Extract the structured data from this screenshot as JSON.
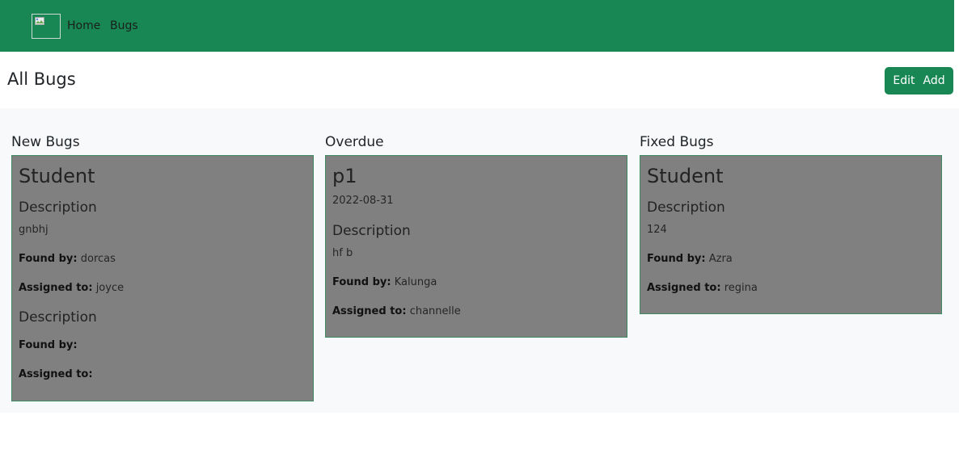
{
  "nav": {
    "brand_icon": "broken-image-icon",
    "links": [
      "Home",
      "Bugs"
    ]
  },
  "header": {
    "title": "All Bugs",
    "actions": [
      "Edit",
      "Add"
    ]
  },
  "colors": {
    "primary": "#198754",
    "card_bg": "#808080",
    "board_bg": "#f8f9fa"
  },
  "columns": [
    {
      "title": "New Bugs",
      "cards": [
        {
          "title": "Student",
          "entries": [
            {
              "heading": "Description",
              "description": "gnbhj",
              "found_label": "Found by:",
              "found_by": "dorcas",
              "assigned_label": "Assigned to:",
              "assigned_to": "joyce"
            },
            {
              "heading": "Description",
              "description": "",
              "found_label": "Found by:",
              "found_by": "",
              "assigned_label": "Assigned to:",
              "assigned_to": ""
            }
          ]
        }
      ]
    },
    {
      "title": "Overdue",
      "cards": [
        {
          "title": "p1",
          "date": "2022-08-31",
          "entries": [
            {
              "heading": "Description",
              "description": "hf b",
              "found_label": "Found by:",
              "found_by": "Kalunga",
              "assigned_label": "Assigned to:",
              "assigned_to": "channelle"
            }
          ]
        }
      ]
    },
    {
      "title": "Fixed Bugs",
      "cards": [
        {
          "title": "Student",
          "entries": [
            {
              "heading": "Description",
              "description": "124",
              "found_label": "Found by:",
              "found_by": "Azra",
              "assigned_label": "Assigned to:",
              "assigned_to": "regina"
            }
          ]
        }
      ]
    }
  ]
}
